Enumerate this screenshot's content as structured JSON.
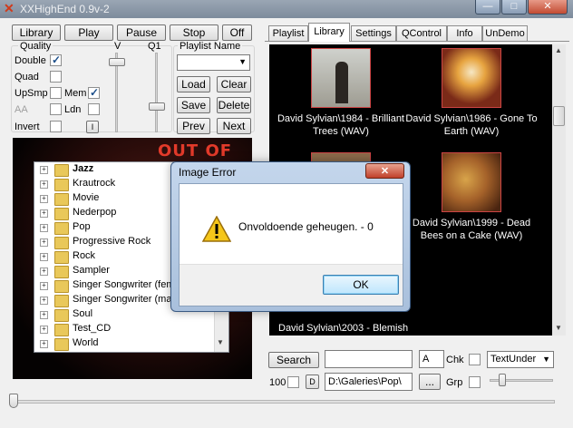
{
  "window": {
    "title": "XXHighEnd 0.9v-2"
  },
  "titlebar_buttons": [
    "—",
    "□",
    "✕"
  ],
  "transport": {
    "library": "Library",
    "play": "Play",
    "pause": "Pause",
    "stop": "Stop",
    "off": "Off"
  },
  "quality": {
    "title": "Quality",
    "v_label": "V",
    "q1_label": "Q1",
    "double": "Double",
    "quad": "Quad",
    "upsmp": "UpSmp",
    "mem": "Mem",
    "aa": "AA",
    "ldn": "Ldn",
    "invert": "Invert",
    "i_button": "I"
  },
  "playlist_name": {
    "label": "Playlist Name",
    "value": ""
  },
  "playlist_buttons": {
    "load": "Load",
    "clear": "Clear",
    "save": "Save",
    "delete": "Delete",
    "prev": "Prev",
    "next": "Next"
  },
  "cover_text": "OUT OF THE",
  "tree": {
    "items": [
      "Jazz",
      "Krautrock",
      "Movie",
      "Nederpop",
      "Pop",
      "Progressive Rock",
      "Rock",
      "Sampler",
      "Singer Songwriter (fem",
      "Singer Songwriter (mal",
      "Soul",
      "Test_CD",
      "World"
    ]
  },
  "tabs": [
    "Playlist",
    "Library",
    "Settings",
    "QControl",
    "Info",
    "UnDemo"
  ],
  "albums": [
    {
      "caption": "David Sylvian\\1984 - Brilliant Trees (WAV)"
    },
    {
      "caption": "David Sylvian\\1986 - Gone To Earth (WAV)"
    },
    {
      "caption": "David Sylvian\\1999 - Dead Bees on a Cake (WAV)"
    },
    {
      "caption": "David Sylvian\\2003 - Blemish"
    }
  ],
  "bottom": {
    "search": "Search",
    "search_value": "",
    "a_value": "A",
    "chk": "Chk",
    "grp": "Grp",
    "textunder": "TextUnder",
    "hundred": "100",
    "d_button": "D",
    "path": "D:\\Galeries\\Pop\\",
    "ellipsis": "..."
  },
  "dialog": {
    "title": "Image Error",
    "message": "Onvoldoende geheugen. - 0",
    "ok": "OK",
    "close": "✕"
  },
  "colors": {
    "accent": "#3399ff",
    "dialog_border": "#3b5a82",
    "library_bg": "#000000"
  }
}
